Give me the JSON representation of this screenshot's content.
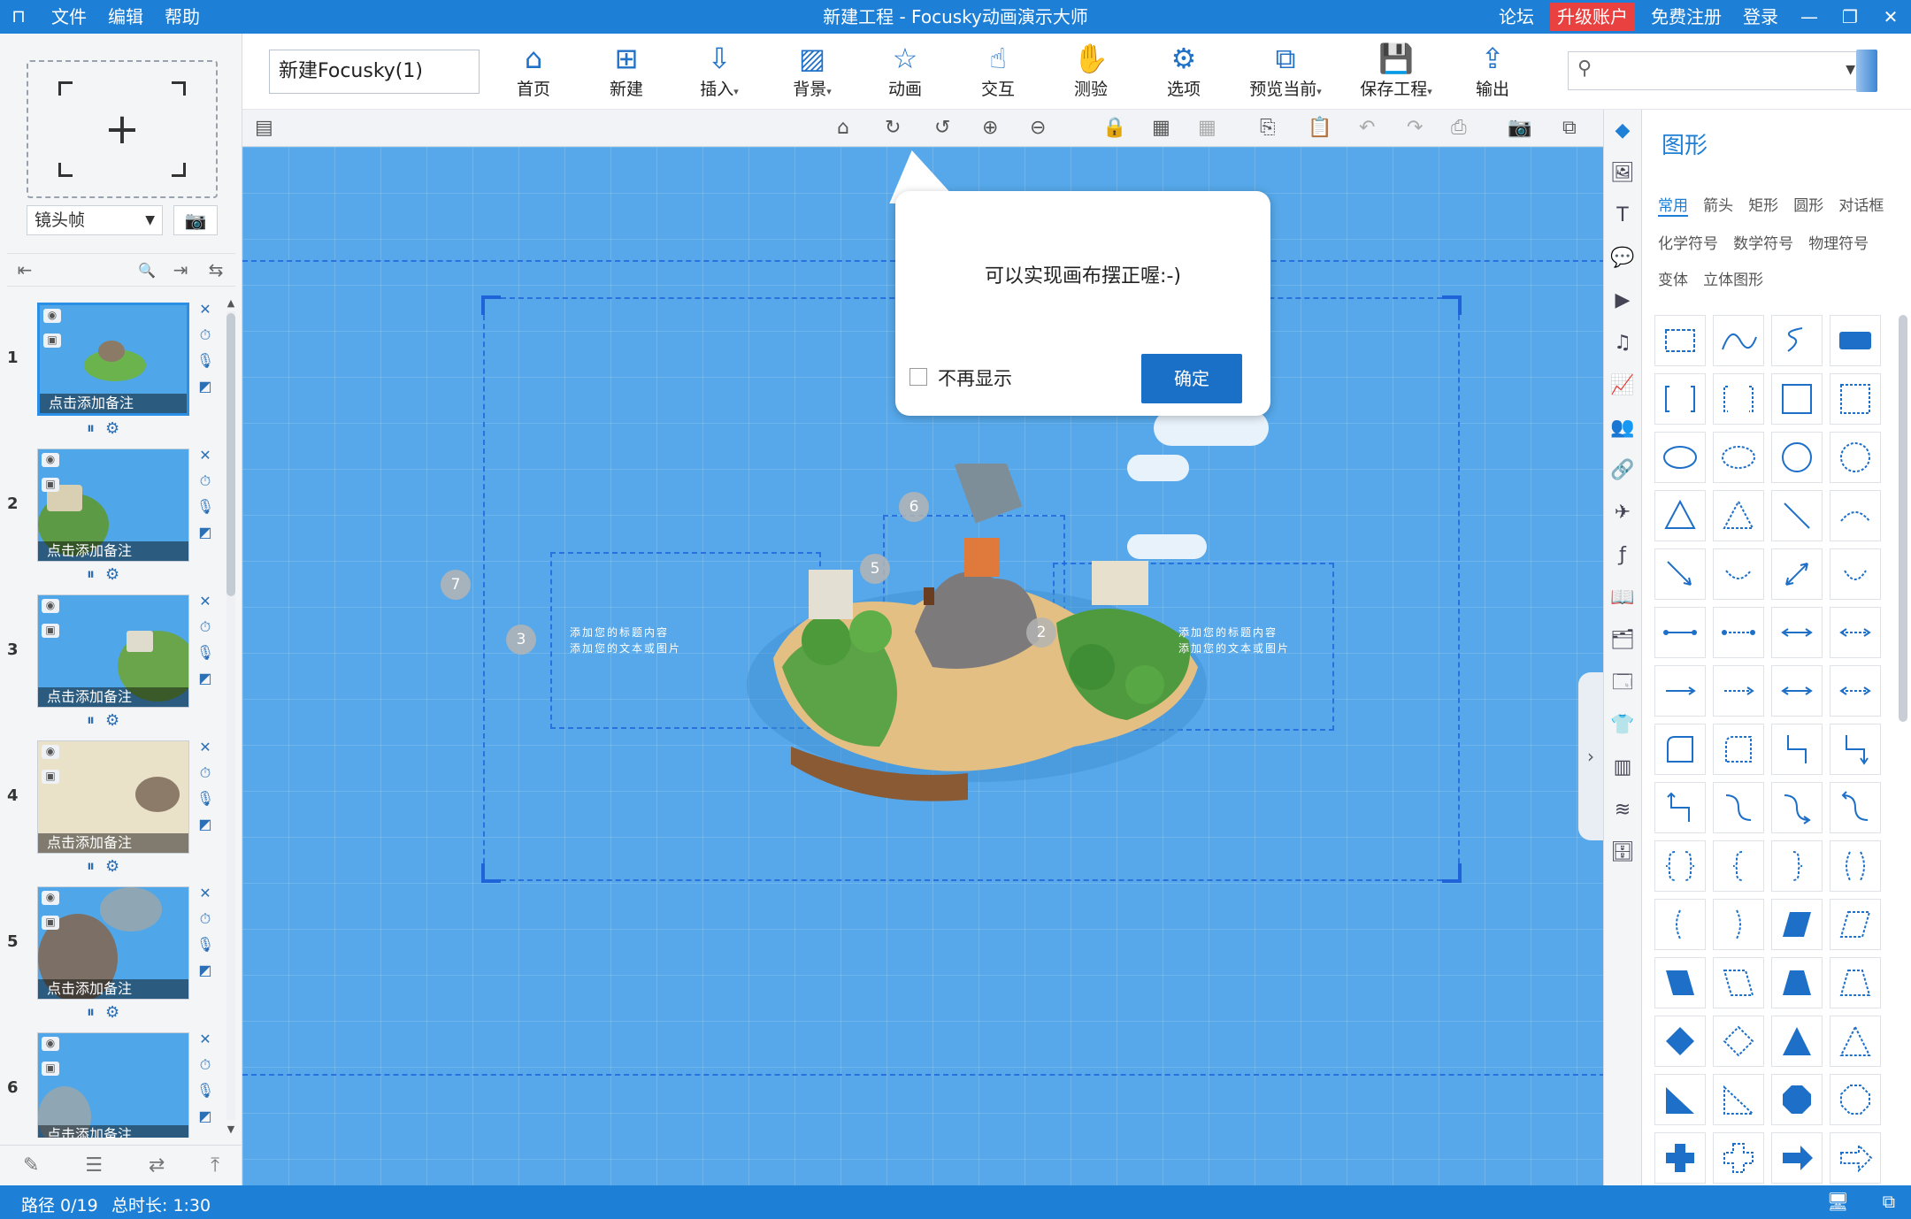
{
  "app": {
    "title": "新建工程 - Focusky动画演示大师",
    "menu": [
      "文件",
      "编辑",
      "帮助"
    ],
    "right_links": {
      "forum": "论坛",
      "upgrade": "升级账户",
      "register": "免费注册",
      "login": "登录"
    },
    "accent_color": "#1e7fd6"
  },
  "left_panel": {
    "frame_type": "镜头帧",
    "note_label": "点击添加备注",
    "thumbnails": [
      {
        "number": "1",
        "selected": true
      },
      {
        "number": "2",
        "selected": false
      },
      {
        "number": "3",
        "selected": false
      },
      {
        "number": "4",
        "selected": false
      },
      {
        "number": "5",
        "selected": false
      },
      {
        "number": "6",
        "selected": false
      }
    ]
  },
  "toolbar": {
    "project_name": "新建Focusky(1)",
    "buttons": [
      {
        "label": "首页",
        "icon": "home-icon"
      },
      {
        "label": "新建",
        "icon": "new-icon"
      },
      {
        "label": "插入",
        "icon": "insert-icon"
      },
      {
        "label": "背景",
        "icon": "background-icon"
      },
      {
        "label": "动画",
        "icon": "animation-icon"
      },
      {
        "label": "交互",
        "icon": "interact-icon"
      },
      {
        "label": "测验",
        "icon": "quiz-icon"
      },
      {
        "label": "选项",
        "icon": "options-icon"
      },
      {
        "label": "预览当前",
        "icon": "preview-icon"
      },
      {
        "label": "保存工程",
        "icon": "save-icon"
      },
      {
        "label": "输出",
        "icon": "export-icon"
      }
    ],
    "search_placeholder": ""
  },
  "canvas": {
    "island_text_a": "添加您的标题内容",
    "island_text_b": "添加您的文本或图片",
    "badges": [
      "7",
      "3",
      "6",
      "5",
      "2"
    ]
  },
  "dialog": {
    "message": "可以实现画布摆正喔:-)",
    "checkbox_label": "不再显示",
    "ok_label": "确定"
  },
  "right_panel": {
    "heading": "图形",
    "categories": [
      "常用",
      "箭头",
      "矩形",
      "圆形",
      "对话框",
      "化学符号",
      "数学符号",
      "物理符号",
      "变体",
      "立体图形"
    ]
  },
  "status": {
    "path": "路径 0/19",
    "duration": "总时长: 1:30"
  }
}
